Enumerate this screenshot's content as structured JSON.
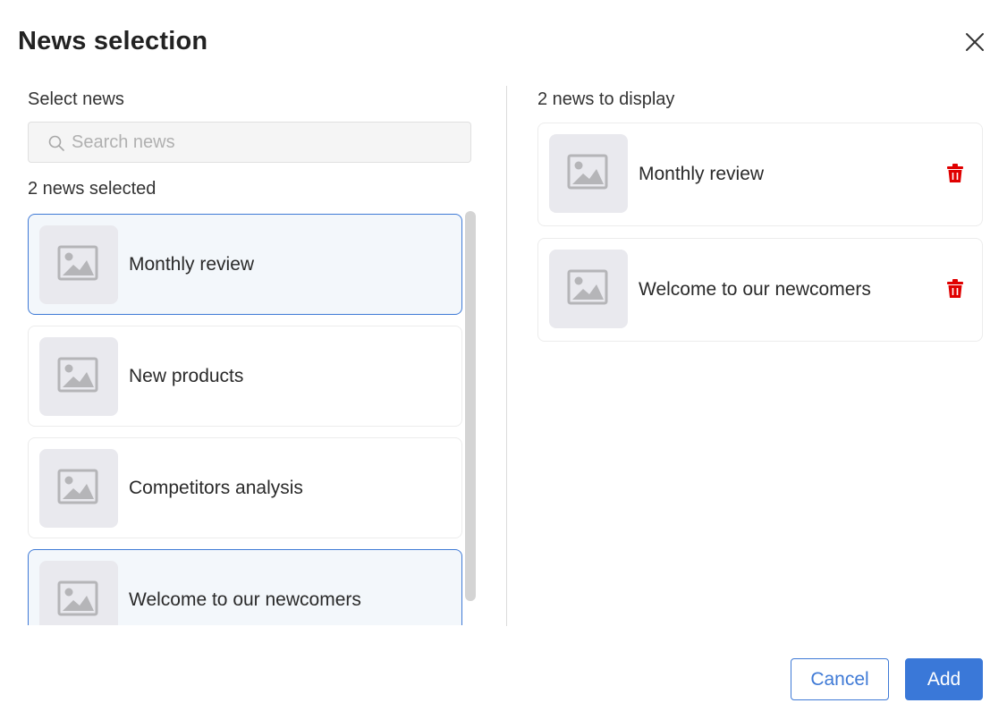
{
  "dialog": {
    "title": "News selection",
    "close_icon": "close-icon"
  },
  "left": {
    "section_label": "Select news",
    "search": {
      "placeholder": "Search news",
      "value": ""
    },
    "selected_count_label": "2 news selected",
    "items": [
      {
        "label": "Monthly review",
        "selected": true,
        "icon": "image-placeholder-icon"
      },
      {
        "label": "New products",
        "selected": false,
        "icon": "image-placeholder-icon"
      },
      {
        "label": "Competitors analysis",
        "selected": false,
        "icon": "image-placeholder-icon"
      },
      {
        "label": "Welcome to our newcomers",
        "selected": true,
        "icon": "image-placeholder-icon"
      }
    ]
  },
  "right": {
    "section_label": "2 news to display",
    "items": [
      {
        "label": "Monthly review",
        "icon": "image-placeholder-icon",
        "action_icon": "trash-icon"
      },
      {
        "label": "Welcome to our newcomers",
        "icon": "image-placeholder-icon",
        "action_icon": "trash-icon"
      }
    ]
  },
  "footer": {
    "cancel_label": "Cancel",
    "add_label": "Add"
  },
  "colors": {
    "accent": "#3a78d8",
    "selected_border": "#3f7ad6",
    "selected_bg": "#f3f7fb",
    "delete": "#e00000"
  }
}
